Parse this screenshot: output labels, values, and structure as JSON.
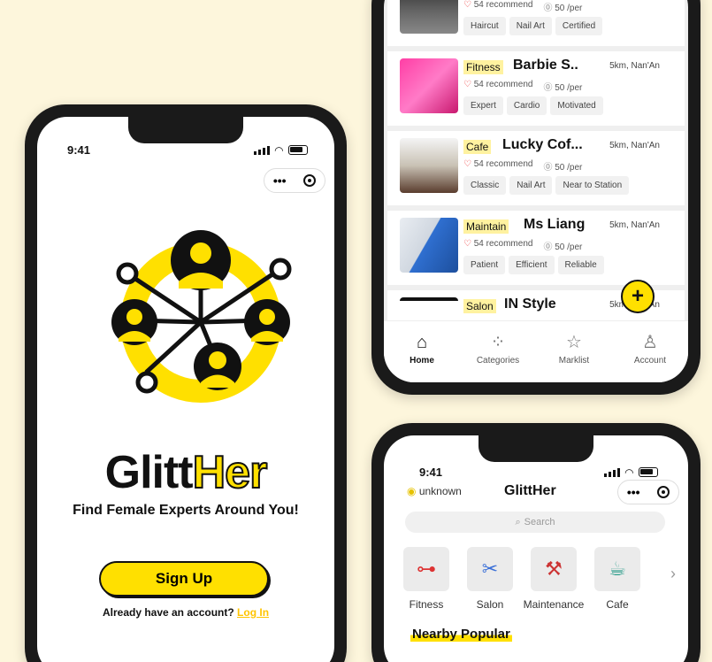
{
  "phone1": {
    "time": "9:41",
    "brand_main": "Glitt",
    "brand_accent": "Her",
    "tagline": "Find Female Experts Around You!",
    "signup_label": "Sign Up",
    "already_text": "Already have an account?",
    "login_label": "Log In"
  },
  "listings": [
    {
      "category": "",
      "title": "",
      "distance": "",
      "recommend": "54 recommend",
      "price": "50 /per",
      "tags": [
        "Haircut",
        "Nail Art",
        "Certified"
      ]
    },
    {
      "category": "Fitness",
      "title": "Barbie S..",
      "distance": "5km, Nan'An",
      "recommend": "54 recommend",
      "price": "50 /per",
      "tags": [
        "Expert",
        "Cardio",
        "Motivated"
      ]
    },
    {
      "category": "Cafe",
      "title": "Lucky Cof...",
      "distance": "5km, Nan'An",
      "recommend": "54 recommend",
      "price": "50 /per",
      "tags": [
        "Classic",
        "Nail Art",
        "Near to Station"
      ]
    },
    {
      "category": "Maintain",
      "title": "Ms Liang",
      "distance": "5km, Nan'An",
      "recommend": "54 recommend",
      "price": "50 /per",
      "tags": [
        "Patient",
        "Efficient",
        "Reliable"
      ]
    },
    {
      "category": "Salon",
      "title": "IN Style",
      "distance": "5km, Nan'An",
      "recommend": "",
      "price": "",
      "tags": []
    }
  ],
  "tabbar": {
    "home": "Home",
    "categories": "Categories",
    "marklist": "Marklist",
    "account": "Account"
  },
  "phone3": {
    "time": "9:41",
    "location": "unknown",
    "app_title": "GlittHer",
    "search_placeholder": "Search",
    "categories": [
      {
        "label": "Fitness",
        "icon": "dumbbell-icon"
      },
      {
        "label": "Salon",
        "icon": "scissors-icon"
      },
      {
        "label": "Maintenance",
        "icon": "tools-icon"
      },
      {
        "label": "Cafe",
        "icon": "coffee-icon"
      }
    ],
    "section_title": "Nearby Popular"
  },
  "colors": {
    "accent": "#ffe000",
    "background": "#fdf6dc",
    "dark": "#1a1a1a"
  }
}
